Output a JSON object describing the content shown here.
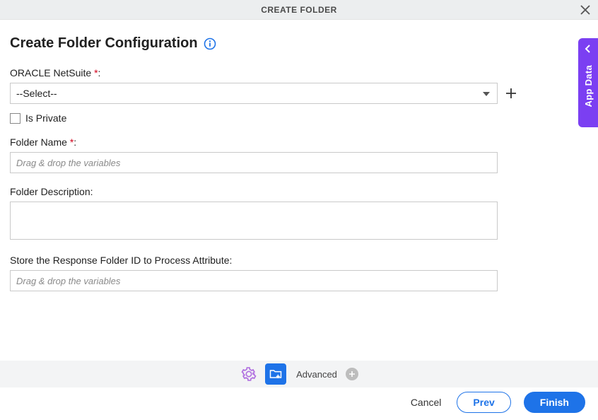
{
  "titlebar": {
    "title": "CREATE FOLDER"
  },
  "pageTitle": "Create Folder Configuration",
  "fields": {
    "oracle": {
      "label": "ORACLE NetSuite ",
      "required": "*",
      "colon": ":",
      "selected": "--Select--"
    },
    "isPrivate": {
      "label": "Is Private"
    },
    "folderName": {
      "label": "Folder Name ",
      "required": "*",
      "colon": ":",
      "placeholder": "Drag & drop the variables"
    },
    "folderDesc": {
      "label": "Folder Description:"
    },
    "storeAttr": {
      "label": "Store the Response Folder ID to Process Attribute:",
      "placeholder": "Drag & drop the variables"
    }
  },
  "footer": {
    "advanced": "Advanced",
    "cancel": "Cancel",
    "prev": "Prev",
    "finish": "Finish"
  },
  "sideTab": {
    "label": "App Data"
  }
}
